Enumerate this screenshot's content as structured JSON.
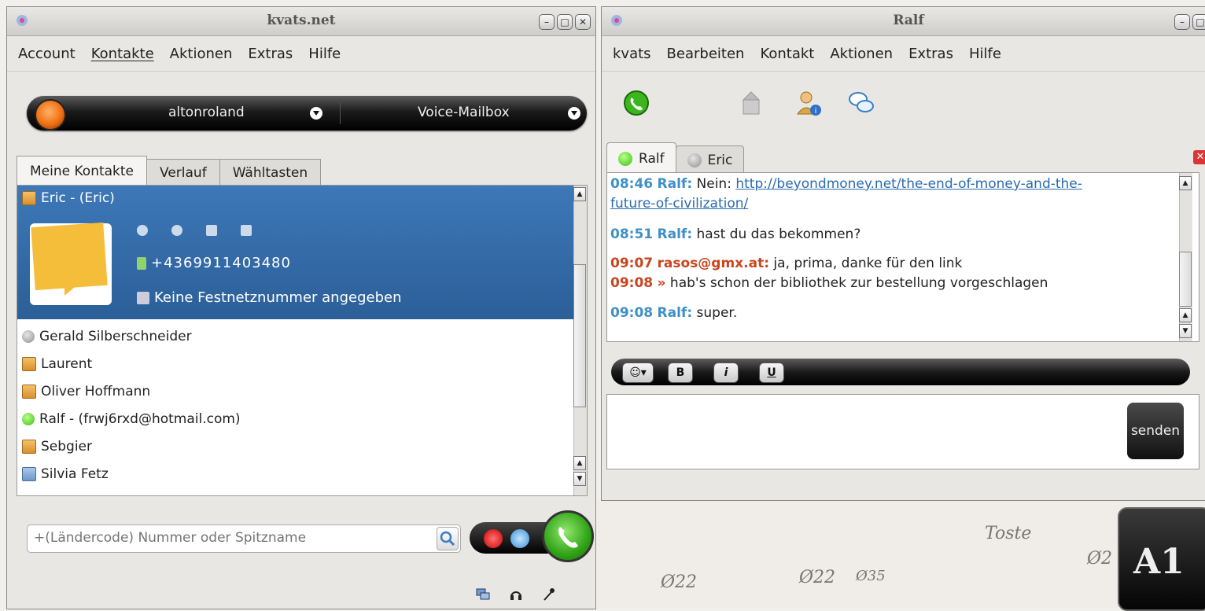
{
  "left_window": {
    "title": "kvats.net",
    "menu": [
      "Account",
      "Kontakte",
      "Aktionen",
      "Extras",
      "Hilfe"
    ],
    "account_name": "altonroland",
    "voicemail_label": "Voice-Mailbox",
    "tabs": [
      "Meine Kontakte",
      "Verlauf",
      "Wähltasten"
    ],
    "selected_contact": {
      "name": "Eric - (Eric)",
      "phone": "+4369911403480",
      "landline": "Keine Festnetznummer angegeben"
    },
    "contacts": [
      {
        "name": "Gerald Silberschneider",
        "icon": "gray-status-icon"
      },
      {
        "name": "Laurent",
        "icon": "contact-card-icon"
      },
      {
        "name": "Oliver Hoffmann",
        "icon": "contact-card-icon"
      },
      {
        "name": "Ralf - (frwj6rxd@hotmail.com)",
        "icon": "green-status-icon"
      },
      {
        "name": "Sebgier",
        "icon": "contact-card-icon"
      },
      {
        "name": "Silvia Fetz",
        "icon": "contact-card-blue-icon"
      }
    ],
    "search_placeholder": "+(Ländercode) Nummer oder Spitzname"
  },
  "right_window": {
    "title": "Ralf",
    "menu": [
      "kvats",
      "Bearbeiten",
      "Kontakt",
      "Aktionen",
      "Extras",
      "Hilfe"
    ],
    "tabs": [
      "Ralf",
      "Eric"
    ],
    "messages": [
      {
        "time": "08:46",
        "sender": "Ralf:",
        "text": "Nein: ",
        "link": "http://beyondmoney.net/the-end-of-money-and-the-",
        "link2": "future-of-civilization/"
      },
      {
        "time": "08:51",
        "sender": "Ralf:",
        "text": "hast du das bekommen?"
      },
      {
        "time": "09:07",
        "sender": "rasos@gmx.at:",
        "text": "ja, prima, danke für den link"
      },
      {
        "time": "09:08",
        "sender": "»",
        "text": "hab's schon der bibliothek zur bestellung vorgeschlagen"
      },
      {
        "time": "09:08",
        "sender": "Ralf:",
        "text": "super."
      }
    ],
    "format_buttons": [
      "B",
      "i",
      "U"
    ],
    "send_label": "senden"
  },
  "desktop": {
    "sketch_texts": [
      "Ø22",
      "Ø22",
      "Ø35",
      "Toste",
      "Ø2"
    ],
    "logo_text": "A1"
  },
  "colors": {
    "selection": "#3d78b8",
    "ralf_time": "#3f8fc6",
    "me_time": "#c8451e"
  }
}
